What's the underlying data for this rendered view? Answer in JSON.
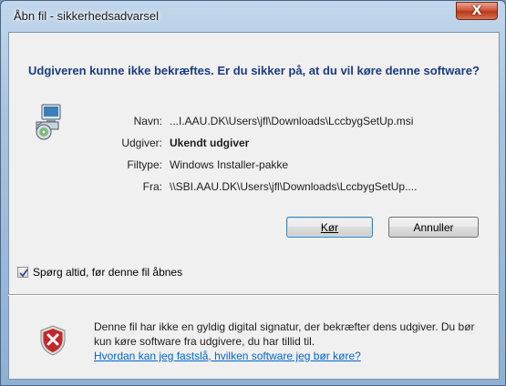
{
  "window": {
    "title": "Åbn fil - sikkerhedsadvarsel",
    "close_label": "X"
  },
  "heading": "Udgiveren kunne ikke bekræftes. Er du sikker på, at du vil køre denne software?",
  "icons": {
    "app": "installer-package-icon",
    "shield": "security-warning-shield-icon",
    "close": "close-icon"
  },
  "fields": [
    {
      "label": "Navn:",
      "value": "...I.AAU.DK\\Users\\jfl\\Downloads\\LccbygSetUp.msi",
      "bold": false
    },
    {
      "label": "Udgiver:",
      "value": "Ukendt udgiver",
      "bold": true
    },
    {
      "label": "Filtype:",
      "value": "Windows Installer-pakke",
      "bold": false
    },
    {
      "label": "Fra:",
      "value": "\\\\SBI.AAU.DK\\Users\\jfl\\Downloads\\LccbygSetUp....",
      "bold": false
    }
  ],
  "buttons": {
    "run": "Kør",
    "cancel": "Annuller"
  },
  "checkbox": {
    "label": "Spørg altid, før denne fil åbnes",
    "checked": true
  },
  "warning": {
    "text": "Denne fil har ikke en gyldig digital signatur, der bekræfter dens udgiver.  Du bør kun køre software fra udgivere, du har tillid til.",
    "link": "Hvordan kan jeg fastslå, hvilken software jeg bør køre?"
  },
  "colors": {
    "heading": "#1b3c80",
    "link": "#0066cc",
    "close_button": "#c8452a"
  }
}
